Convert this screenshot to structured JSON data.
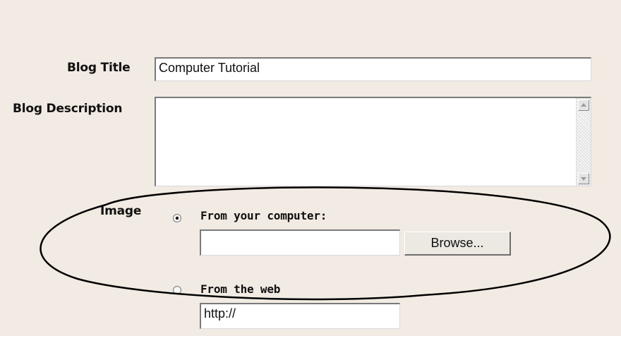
{
  "form": {
    "blog_title_label": "Blog Title",
    "blog_title_value": "Computer Tutorial",
    "blog_description_label": "Blog Description",
    "blog_description_value": "",
    "image_label": "Image",
    "image_options": [
      {
        "label": "From your computer:",
        "selected": true,
        "input_value": "",
        "button_label": "Browse..."
      },
      {
        "label": "From the web",
        "selected": false,
        "input_value": "http://"
      }
    ]
  },
  "colors": {
    "panel_background": "#f2ebe3",
    "annotation_stroke": "#000000"
  },
  "icons": {
    "scroll_up": "scroll-up-arrow-icon",
    "scroll_down": "scroll-down-arrow-icon"
  }
}
